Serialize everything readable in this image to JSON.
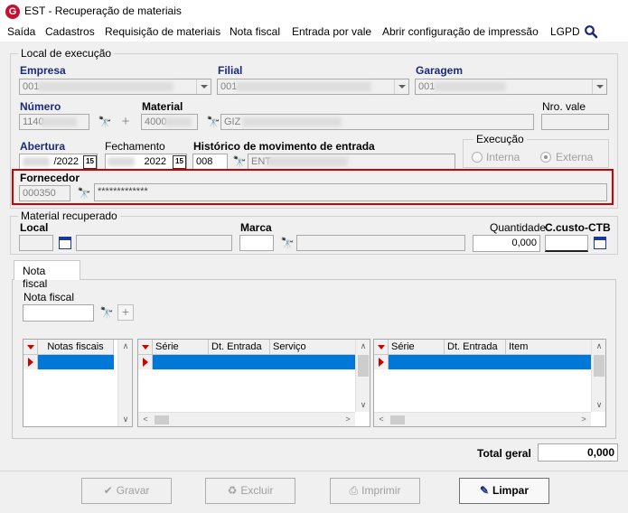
{
  "window": {
    "title": "EST - Recuperação de materiais",
    "app_icon": "app-logo-icon"
  },
  "menu": {
    "items": [
      "Saída",
      "Cadastros",
      "Requisição de materiais",
      "Nota fiscal",
      "Entrada por vale",
      "Abrir configuração de impressão",
      "LGPD"
    ],
    "search_icon": "search-icon"
  },
  "local_execucao": {
    "legend": "Local de execução",
    "empresa": {
      "label": "Empresa",
      "value": "001"
    },
    "filial": {
      "label": "Filial",
      "value": "001"
    },
    "garagem": {
      "label": "Garagem",
      "value": "001"
    },
    "numero": {
      "label": "Número",
      "value": "1140"
    },
    "material": {
      "label": "Material",
      "code": "4000",
      "desc": "GIZ"
    },
    "nro_vale": {
      "label": "Nro. vale",
      "value": ""
    },
    "abertura": {
      "label": "Abertura",
      "value": "/2022"
    },
    "fechamento": {
      "label": "Fechamento",
      "value": "2022"
    },
    "historico": {
      "label": "Histórico de movimento de entrada",
      "code": "008",
      "desc": "ENT"
    },
    "execucao": {
      "legend": "Execução",
      "options": [
        "Interna",
        "Externa"
      ],
      "selected": "Externa"
    },
    "fornecedor": {
      "label": "Fornecedor",
      "code": "000350",
      "name": "*************"
    }
  },
  "material_recuperado": {
    "legend": "Material recuperado",
    "local": {
      "label": "Local",
      "value": ""
    },
    "marca": {
      "label": "Marca",
      "value": ""
    },
    "quantidade": {
      "label": "Quantidade",
      "value": "0,000"
    },
    "ccusto": {
      "label": "C.custo-CTB",
      "value": ""
    }
  },
  "tabs": [
    {
      "label": "Nota fiscal",
      "active": true
    }
  ],
  "nota_fiscal": {
    "label": "Nota fiscal",
    "value": "",
    "grid1": {
      "columns": [
        "Notas fiscais"
      ]
    },
    "grid2": {
      "columns": [
        "Série",
        "Dt. Entrada",
        "Serviço"
      ]
    },
    "grid3": {
      "columns": [
        "Série",
        "Dt. Entrada",
        "Item"
      ]
    }
  },
  "total": {
    "label": "Total geral",
    "value": "0,000"
  },
  "buttons": {
    "gravar": "Gravar",
    "excluir": "Excluir",
    "imprimir": "Imprimir",
    "limpar": "Limpar"
  },
  "colors": {
    "highlight_border": "#d00000",
    "selection": "#0078d7",
    "label_navy": "#1a2a7a"
  }
}
